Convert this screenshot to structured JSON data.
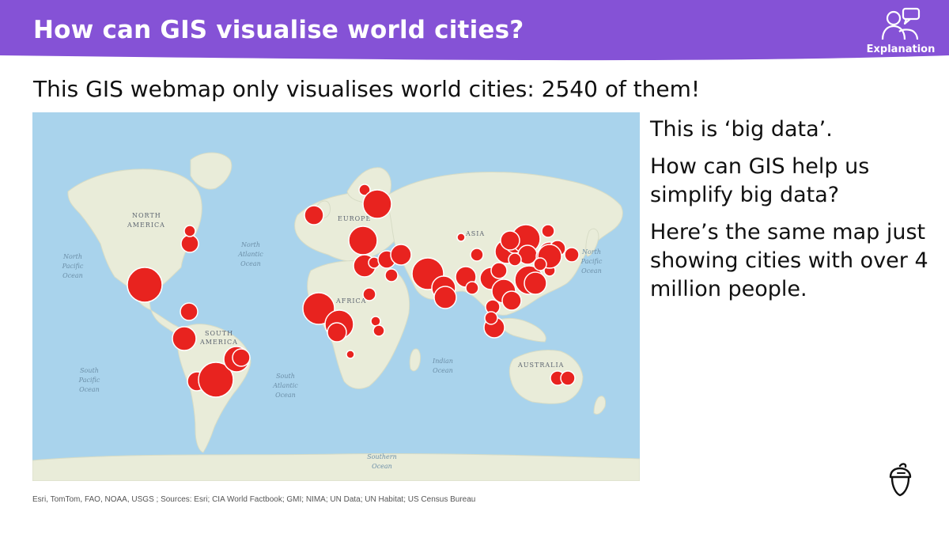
{
  "header": {
    "title": "How can GIS visualise world cities?",
    "badge_label": "Explanation"
  },
  "subtitle": "This GIS webmap only visualises world cities:  2540 of them!",
  "side_text": {
    "line1": "This is ‘big data’.",
    "line2": "How can GIS help us simplify big data?",
    "line3": "Here’s the same map just showing cities with over 4 million people."
  },
  "map": {
    "continent_labels": {
      "north_america": [
        "NORTH",
        "AMERICA"
      ],
      "south_america": [
        "SOUTH",
        "AMERICA"
      ],
      "europe": "EUROPE",
      "asia": "ASIA",
      "africa": "AFRICA",
      "australia": "AUSTRALIA"
    },
    "ocean_labels": {
      "north_atlantic": [
        "North",
        "Atlantic",
        "Ocean"
      ],
      "south_atlantic": [
        "South",
        "Atlantic",
        "Ocean"
      ],
      "north_pacific_west": [
        "North",
        "Pacific",
        "Ocean"
      ],
      "north_pacific_east": [
        "North",
        "Pacific",
        "Ocean"
      ],
      "south_pacific": [
        "South",
        "Pacific",
        "Ocean"
      ],
      "indian": [
        "Indian",
        "Ocean"
      ],
      "southern": [
        "Southern",
        "Ocean"
      ]
    },
    "marker_color": "#e8231f",
    "land_color": "#e9ecd9",
    "ocean_color": "#a9d3ec"
  },
  "credit": "Esri, TomTom, FAO, NOAA, USGS ; Sources: Esri; CIA World Factbook; GMI; NIMA; UN Data; UN Habitat; US Census Bureau",
  "colors": {
    "banner": "#8552d6",
    "text": "#111111"
  },
  "icons": {
    "badge": "people-chat-icon",
    "logo": "acorn-logo-icon"
  }
}
